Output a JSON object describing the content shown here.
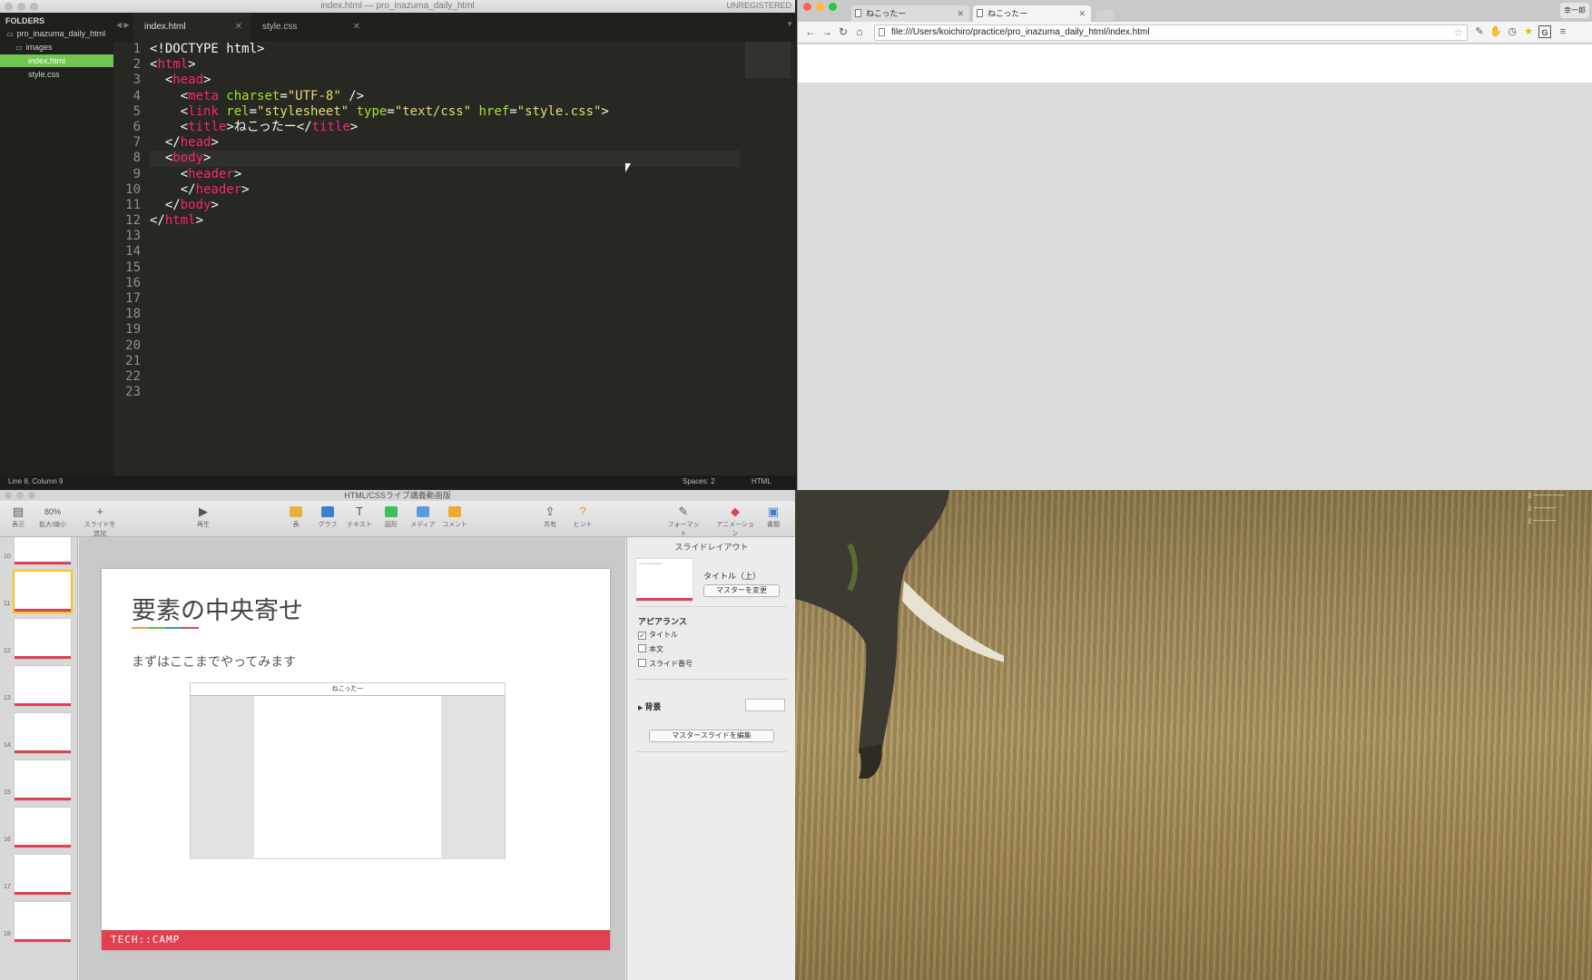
{
  "editor": {
    "window_title": "index.html — pro_inazuma_daily_html",
    "unregistered": "UNREGISTERED",
    "sidebar": {
      "header": "FOLDERS",
      "items": [
        {
          "label": "pro_inazuma_daily_html",
          "type": "folder"
        },
        {
          "label": "images",
          "type": "folder"
        },
        {
          "label": "index.html",
          "type": "file",
          "active": true
        },
        {
          "label": "style.css",
          "type": "file"
        }
      ]
    },
    "tabs": [
      {
        "label": "index.html",
        "active": true
      },
      {
        "label": "style.css",
        "active": false
      }
    ],
    "line_numbers": [
      "1",
      "2",
      "3",
      "4",
      "5",
      "6",
      "7",
      "8",
      "9",
      "10",
      "11",
      "12",
      "13",
      "14",
      "15",
      "16",
      "17",
      "18",
      "19",
      "20",
      "21",
      "22",
      "23"
    ],
    "status": {
      "position": "Line 8, Column 9",
      "spaces": "Spaces: 2",
      "syntax": "HTML"
    }
  },
  "code": {
    "l1": "<!DOCTYPE html>",
    "l2a": "<",
    "l2b": "html",
    "l2c": ">",
    "l3a": "  <",
    "l3b": "head",
    "l3c": ">",
    "l4a": "    <",
    "l4b": "meta",
    "l4c": " charset",
    "l4d": "=",
    "l4e": "\"UTF-8\"",
    "l4f": " />",
    "l5a": "    <",
    "l5b": "link",
    "l5c": " rel",
    "l5d": "=",
    "l5e": "\"stylesheet\"",
    "l5f": " type",
    "l5g": "=",
    "l5h": "\"text/css\"",
    "l5i": " href",
    "l5j": "=",
    "l5k": "\"style.css\"",
    "l5l": ">",
    "l6a": "    <",
    "l6b": "title",
    "l6c": ">ねこったー</",
    "l6d": "title",
    "l6e": ">",
    "l7a": "  </",
    "l7b": "head",
    "l7c": ">",
    "l8a": "  <",
    "l8b": "body",
    "l8c": ">",
    "l9a": "    <",
    "l9b": "header",
    "l9c": ">",
    "l10a": "    </",
    "l10b": "header",
    "l10c": ">",
    "l11a": "  </",
    "l11b": "body",
    "l11c": ">",
    "l12a": "</",
    "l12b": "html",
    "l12c": ">"
  },
  "browser": {
    "tabs": [
      {
        "label": "ねこったー",
        "active": false
      },
      {
        "label": "ねこったー",
        "active": true
      }
    ],
    "user_button": "幸一郎",
    "url": "file:///Users/koichiro/practice/pro_inazuma_daily_html/index.html"
  },
  "keynote": {
    "window_title": "HTML/CSSライブ講義動画版",
    "toolbar": {
      "view": "表示",
      "zoom_value": "80%",
      "zoom": "拡大/縮小",
      "add_slide": "スライドを追加",
      "play": "再生",
      "table": "表",
      "chart": "グラフ",
      "text": "テキスト",
      "shape": "図形",
      "media": "メディア",
      "comment": "コメント",
      "share": "共有",
      "tips": "ヒント",
      "format": "フォーマット",
      "animate": "アニメーション",
      "document": "書類"
    },
    "slide_numbers": [
      "10",
      "11",
      "12",
      "13",
      "14",
      "15",
      "16",
      "17",
      "18"
    ],
    "slide": {
      "title": "要素の中央寄せ",
      "body": "まずはここまでやってみます",
      "mock_header": "ねこったー",
      "footer": "TECH::CAMP"
    },
    "inspector": {
      "title": "スライドレイアウト",
      "layout_name": "タイトル（上）",
      "change_master": "マスターを変更",
      "appearance": "アピアランス",
      "options": [
        {
          "label": "タイトル",
          "checked": true
        },
        {
          "label": "本文",
          "checked": false
        },
        {
          "label": "スライド番号",
          "checked": false
        }
      ],
      "background": "背景",
      "edit_master": "マスタースライドを編集"
    }
  },
  "colors": {
    "editor_bg": "#272822",
    "tag": "#f92672",
    "attr": "#a6e22e",
    "string": "#e6db74",
    "sidebar_active": "#71c551",
    "slide_accent": "#e0404f"
  }
}
